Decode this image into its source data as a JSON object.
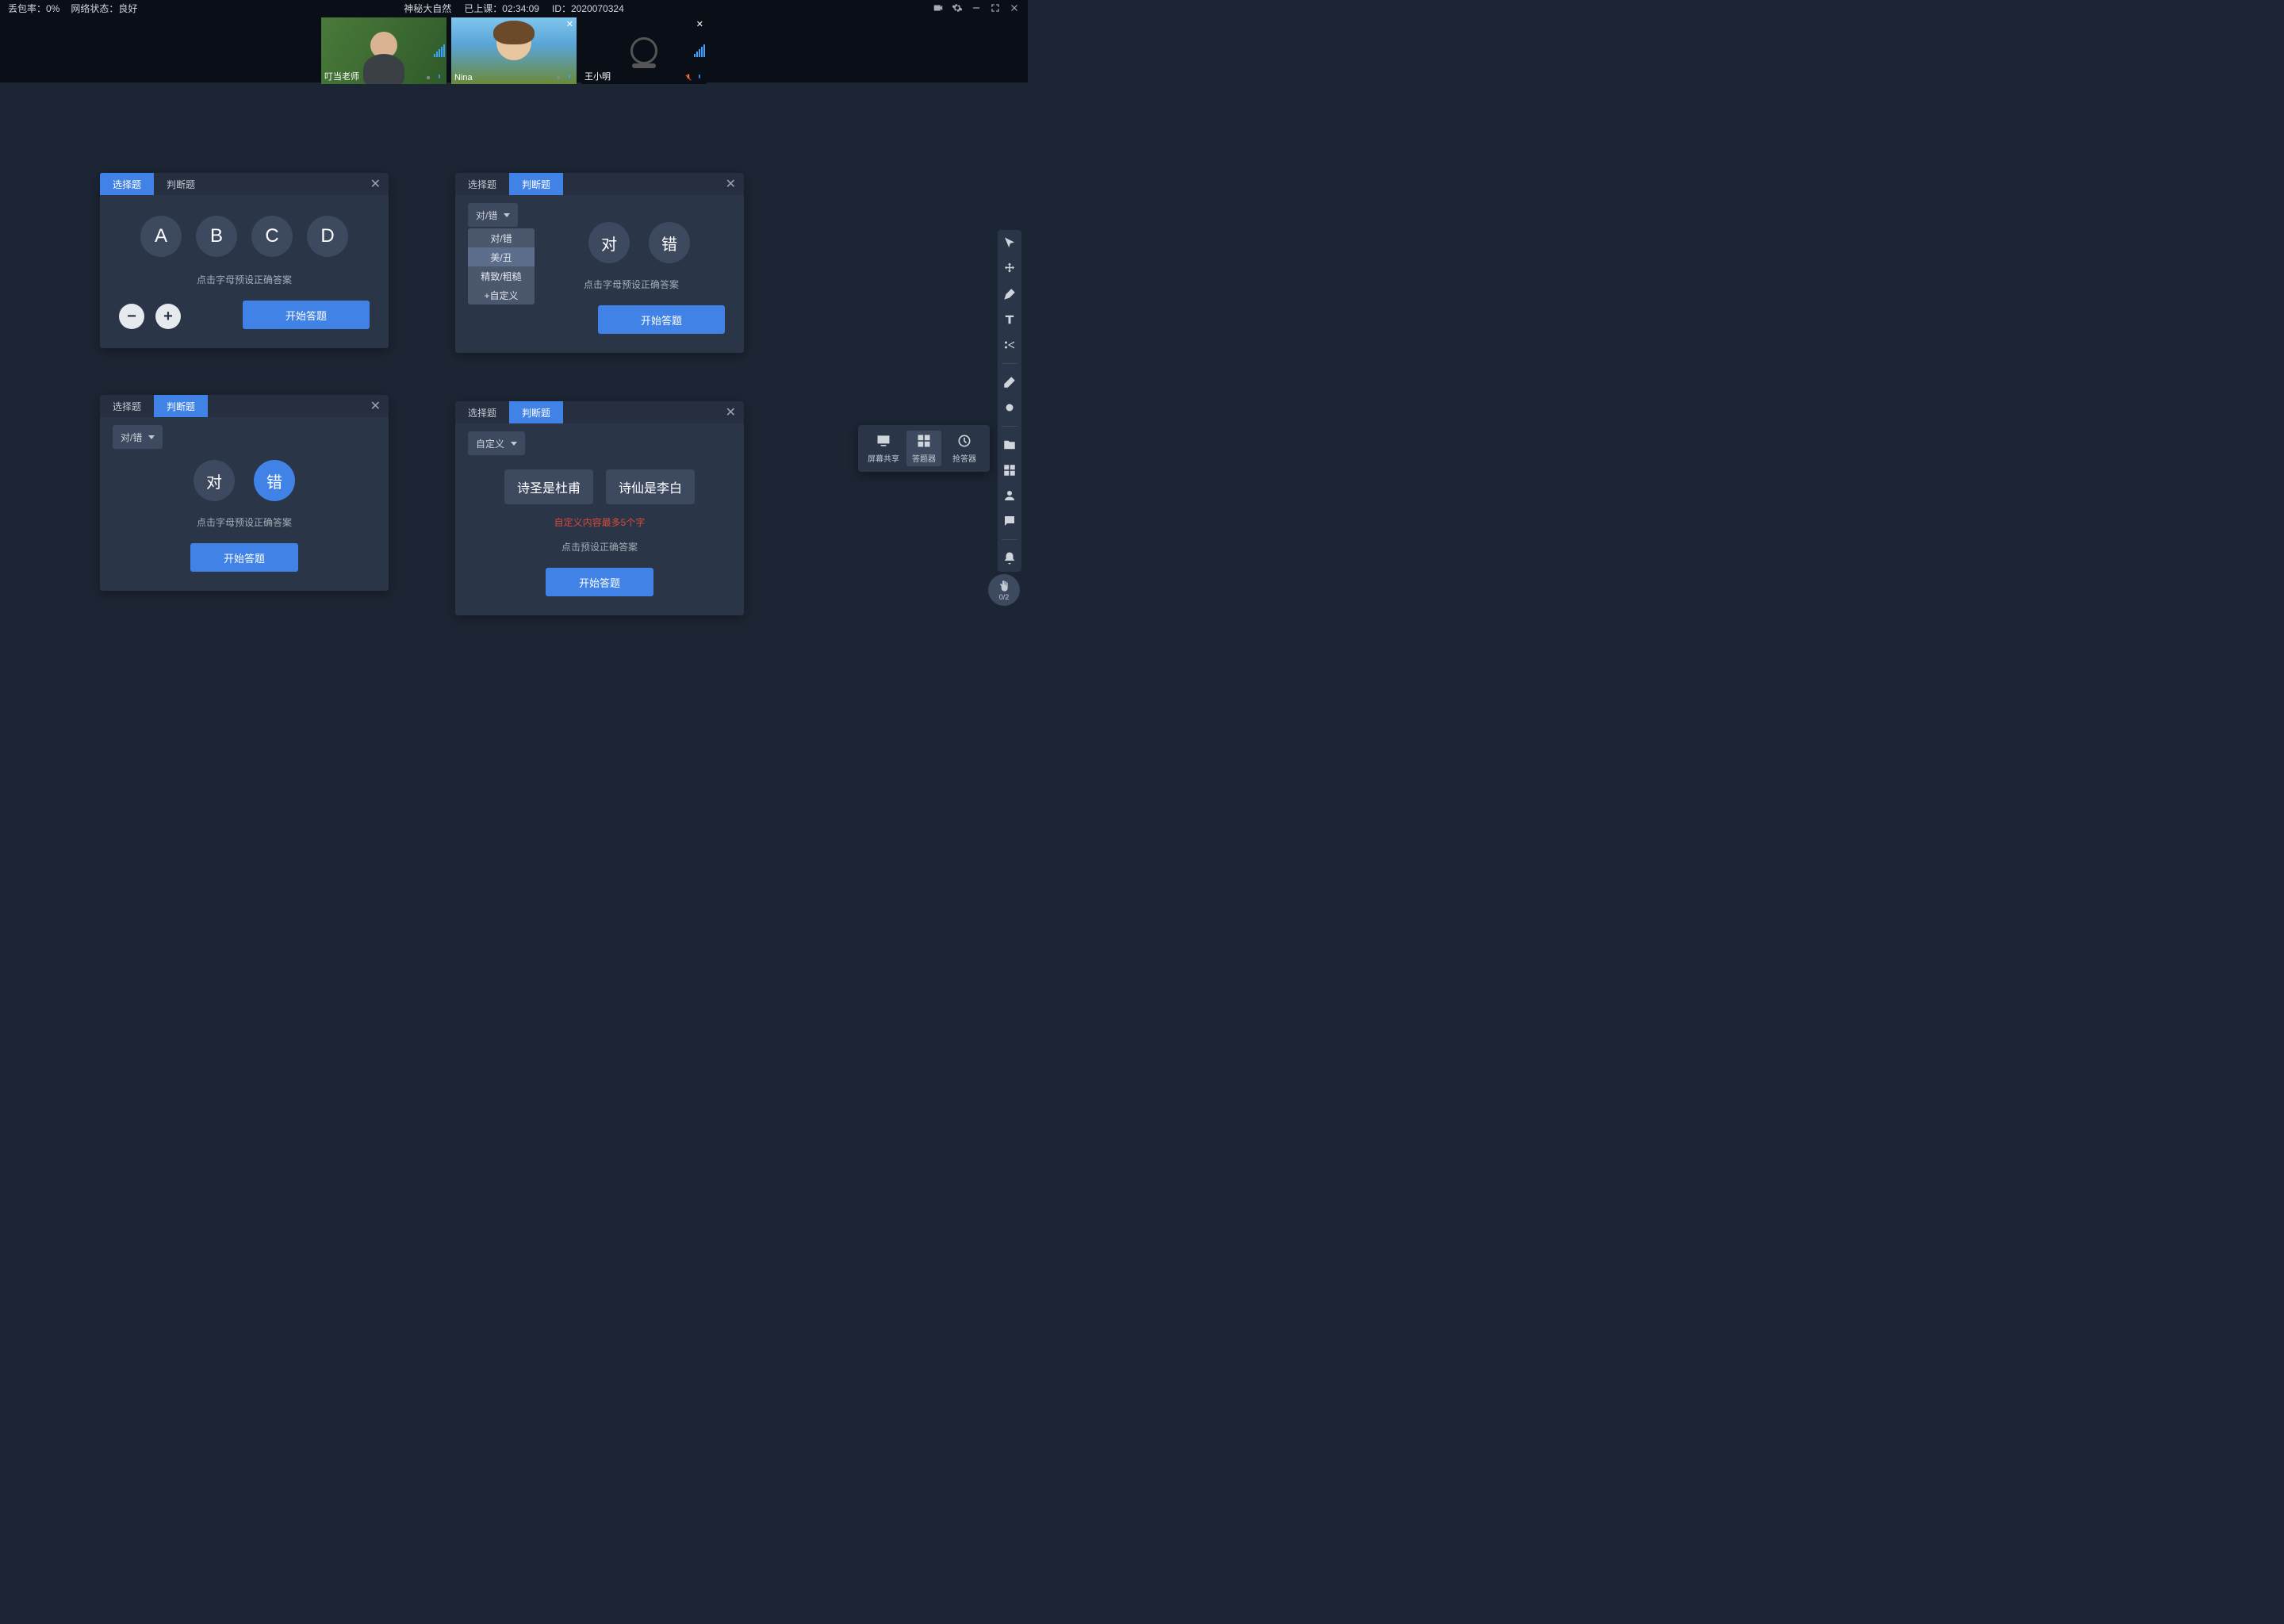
{
  "topbar": {
    "packet_loss": "丢包率：0%",
    "network": "网络状态：良好",
    "title": "神秘大自然",
    "elapsed_label": "已上课：",
    "elapsed_time": "02:34:09",
    "id_label": "ID：",
    "id_value": "2020070324"
  },
  "videos": {
    "teacher": "叮当老师",
    "student1": "Nina",
    "student2": "王小明"
  },
  "panel1": {
    "tab_choice": "选择题",
    "tab_tf": "判断题",
    "letters": [
      "A",
      "B",
      "C",
      "D"
    ],
    "hint": "点击字母预设正确答案",
    "start": "开始答题"
  },
  "panel2": {
    "tab_choice": "选择题",
    "tab_tf": "判断题",
    "dropdown_selected": "对/错",
    "dropdown_options": [
      "对/错",
      "美/丑",
      "精致/粗糙",
      "+自定义"
    ],
    "opt_true": "对",
    "opt_false": "错",
    "hint": "点击字母预设正确答案",
    "start": "开始答题"
  },
  "panel3": {
    "tab_choice": "选择题",
    "tab_tf": "判断题",
    "dropdown_selected": "对/错",
    "opt_true": "对",
    "opt_false": "错",
    "hint": "点击字母预设正确答案",
    "start": "开始答题"
  },
  "panel4": {
    "tab_choice": "选择题",
    "tab_tf": "判断题",
    "dropdown_selected": "自定义",
    "custom1": "诗圣是杜甫",
    "custom2": "诗仙是李白",
    "warn": "自定义内容最多5个字",
    "hint": "点击预设正确答案",
    "start": "开始答题"
  },
  "tools": {
    "screen_share": "屏幕共享",
    "answer_tool": "答题器",
    "buzzer": "抢答器"
  },
  "hand": {
    "count": "0/2"
  }
}
